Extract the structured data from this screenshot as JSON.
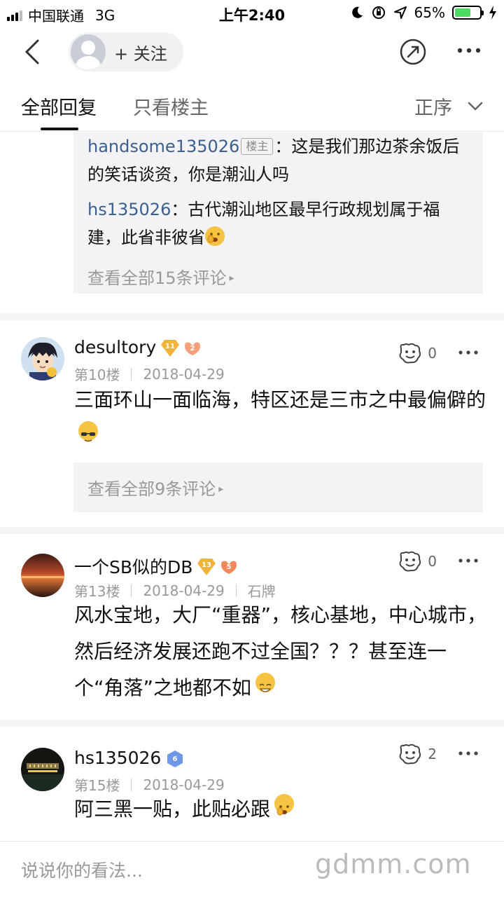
{
  "status_bar": {
    "carrier": "中国联通",
    "network": "3G",
    "time": "上午2:40",
    "battery": "65%",
    "battery_level": 0.65
  },
  "nav": {
    "follow_label": "+ 关注",
    "back_icon": "chevron-left-icon",
    "share_icon": "share-icon",
    "more_icon": "more-icon"
  },
  "tabs": {
    "all": "全部回复",
    "owner_only": "只看楼主",
    "sort": "正序"
  },
  "top_replies": {
    "items": [
      {
        "user": "handsome135026",
        "tag": "楼主",
        "text": "：这是我们那边茶余饭后的笑话谈资，你是潮汕人吗"
      },
      {
        "user": "hs135026",
        "text": "：古代潮汕地区最早行政规划属于福建，此省非彼省"
      }
    ],
    "view_all": "查看全部15条评论"
  },
  "posts": [
    {
      "name": "desultory",
      "badges": [
        "11",
        "2"
      ],
      "floor": "第10楼",
      "date": "2018-04-29",
      "extra": "",
      "likes": "0",
      "body": "三面环山一面临海，特区还是三市之中最偏僻的",
      "view_all": "查看全部9条评论"
    },
    {
      "name": "一个SB似的DB",
      "badges": [
        "13",
        "5"
      ],
      "floor": "第13楼",
      "date": "2018-04-29",
      "extra": "石牌",
      "likes": "0",
      "body": "风水宝地，大厂“重器”，核心基地，中心城市，然后经济发展还跑不过全国？？？甚至连一个“角落”之地都不如"
    },
    {
      "name": "hs135026",
      "badges": [
        "6"
      ],
      "floor": "第15楼",
      "date": "2018-04-29",
      "extra": "",
      "likes": "2",
      "body": "阿三黑一贴，此贴必跟"
    }
  ],
  "input_bar": {
    "placeholder": "说说你的看法...",
    "watermark": "gdmm.com"
  },
  "colors": {
    "link_user": "#3b5f8e",
    "level_badge": "#f2b33d",
    "fan_badge": "#f08a5d",
    "verified_badge": "#6f98e8"
  }
}
